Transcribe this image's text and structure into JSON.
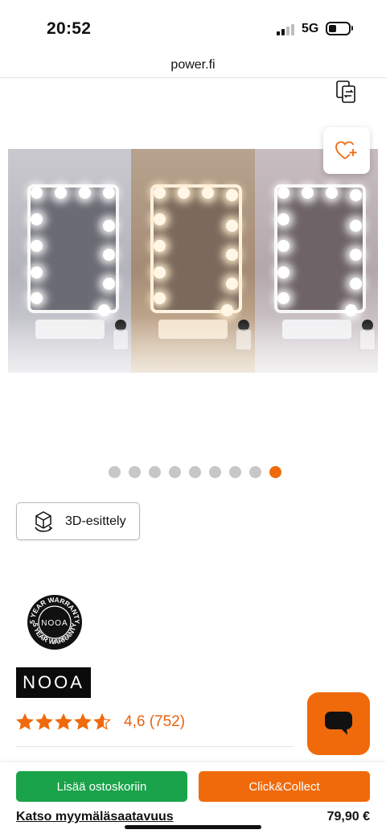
{
  "status_bar": {
    "time": "20:52",
    "network": "5G",
    "signal_bars_filled": 2,
    "signal_bars_total": 4,
    "battery_icon": "battery-icon"
  },
  "browser": {
    "url": "power.fi"
  },
  "header": {
    "compare_icon": "compare-icon"
  },
  "gallery": {
    "slides": [
      {
        "light": "cool-white"
      },
      {
        "light": "warm"
      },
      {
        "light": "neutral"
      }
    ],
    "dots_total": 9,
    "active_dot_index": 8,
    "wishlist_icon": "heart-plus-icon"
  },
  "product": {
    "button_3d_label": "3D-esittely",
    "button_3d_icon": "cube-3d-icon",
    "warranty_badge": {
      "top_text": "5 YEAR WARRANTY",
      "bottom_text": "5 YEAR WARRANTY",
      "brand": "NOOA"
    },
    "brand": "NOOA",
    "rating": {
      "stars": 4.6,
      "text": "4,6 (752)"
    }
  },
  "chat": {
    "icon": "chat-bubble-icon"
  },
  "bottom_bar": {
    "add_to_cart_label": "Lisää ostoskoriin",
    "click_collect_label": "Click&Collect",
    "store_availability_label": "Katso myymäläsaatavuus",
    "price": "79,90 €"
  },
  "colors": {
    "accent_orange": "#f06a0c",
    "cart_green": "#1aa34a",
    "rating_text": "#e7630f",
    "dot_inactive": "#c7c7c7"
  }
}
